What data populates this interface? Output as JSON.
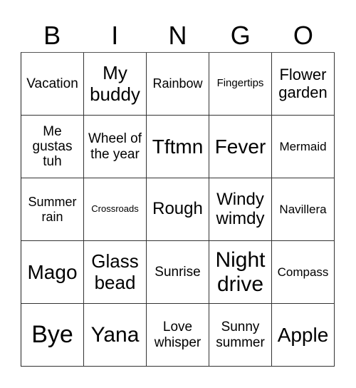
{
  "header": [
    "B",
    "I",
    "N",
    "G",
    "O"
  ],
  "cells": [
    [
      "Vacation",
      "My buddy",
      "Rainbow",
      "Fingertips",
      "Flower garden"
    ],
    [
      "Me gustas tuh",
      "Wheel of the year",
      "Tftmn",
      "Fever",
      "Mermaid"
    ],
    [
      "Summer rain",
      "Crossroads",
      "Rough",
      "Windy wimdy",
      "Navillera"
    ],
    [
      "Mago",
      "Glass bead",
      "Sunrise",
      "Night drive",
      "Compass"
    ],
    [
      "Bye",
      "Yana",
      "Love whisper",
      "Sunny summer",
      "Apple"
    ]
  ]
}
